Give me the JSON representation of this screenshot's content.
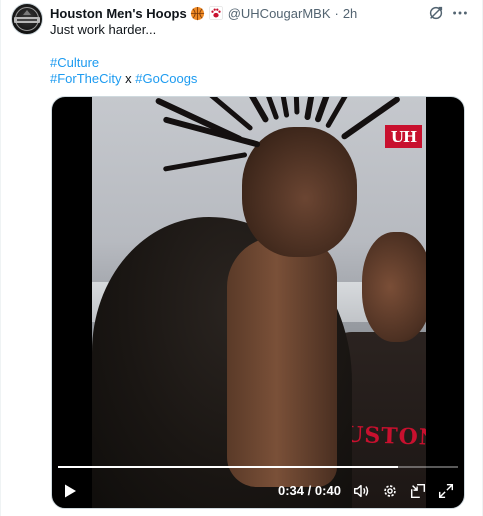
{
  "post": {
    "display_name": "Houston Men's Hoops",
    "handle": "@UHCougarMBK",
    "separator": "·",
    "timestamp": "2h",
    "icons": {
      "verified": "basketball-badge-icon",
      "affiliate": "paw-print-icon",
      "grok": "grok-icon",
      "more": "more-options-icon"
    },
    "text_line1": "Just work harder...",
    "hashtag_culture": "#Culture",
    "hashtag_forthecity": "#ForTheCity",
    "connector": "x",
    "hashtag_gocoogs": "#GoCoogs",
    "hashtag_color": "#1d9bf0"
  },
  "video": {
    "logo_text": "UH",
    "jersey_text": "OUSTON",
    "current_time": "0:34",
    "time_sep": "/",
    "duration": "0:40",
    "progress_fraction": 0.85,
    "accent": "#c8102e",
    "controls": [
      "play-icon",
      "volume-icon",
      "settings-icon",
      "picture-in-picture-icon",
      "fullscreen-icon"
    ]
  }
}
